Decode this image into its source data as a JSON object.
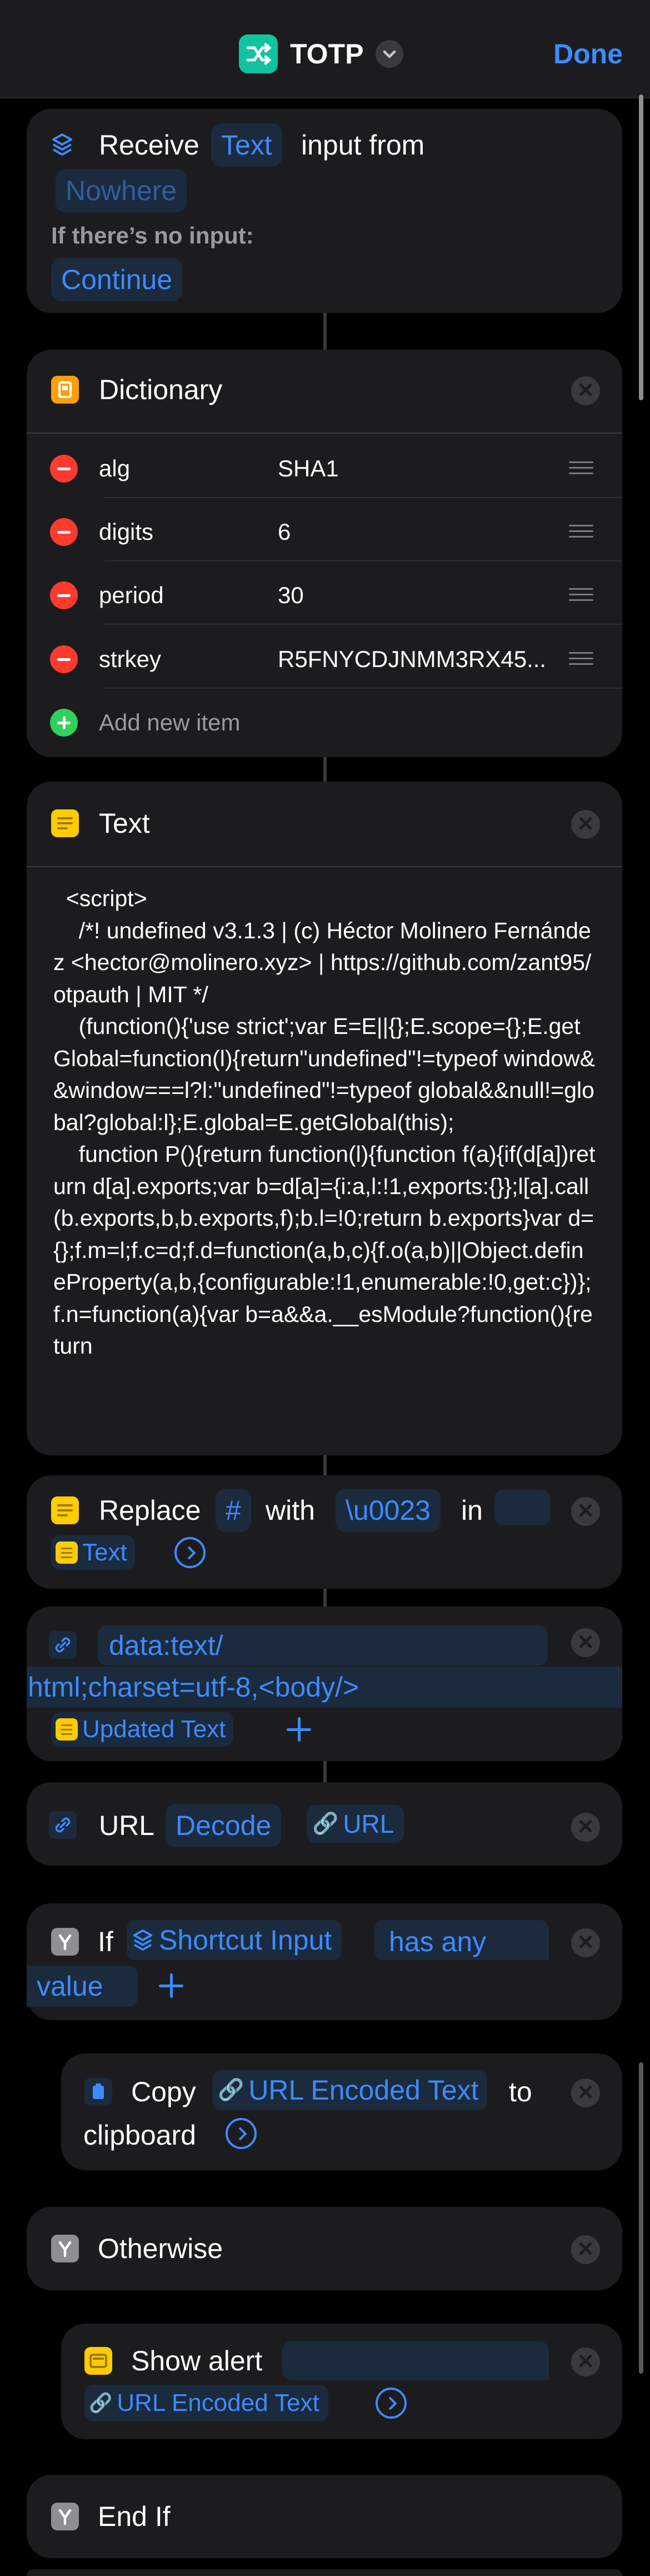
{
  "nav": {
    "title": "TOTP",
    "done": "Done",
    "app_icon": "shuffle-icon",
    "chevron_icon": "chevron-down-icon"
  },
  "receive": {
    "label_receive": "Receive",
    "input_type": "Text",
    "label_input_from": "input from",
    "source": "Nowhere",
    "no_input_label": "If there’s no input:",
    "no_input_action": "Continue"
  },
  "dictionary": {
    "title": "Dictionary",
    "items": [
      {
        "key": "alg",
        "value": "SHA1"
      },
      {
        "key": "digits",
        "value": "6"
      },
      {
        "key": "period",
        "value": "30"
      },
      {
        "key": "strkey",
        "value": "R5FNYCDJNMM3RX45..."
      }
    ],
    "add_label": "Add new item"
  },
  "text_action": {
    "title": "Text",
    "content": "  <script>\n    /*! undefined v3.1.3 | (c) Héctor Molinero Fernández <hector@molinero.xyz> | https://github.com/zant95/otpauth | MIT */\n    (function(){'use strict';var E=E||{};E.scope={};E.getGlobal=function(l){return\"undefined\"!=typeof window&&window===l?l:\"undefined\"!=typeof global&&null!=global?global:l};E.global=E.getGlobal(this);\n    function P(){return function(l){function f(a){if(d[a])return d[a].exports;var b=d[a]={i:a,l:!1,exports:{}};l[a].call(b.exports,b,b.exports,f);b.l=!0;return b.exports}var d={};f.m=l;f.c=d;f.d=function(a,b,c){f.o(a,b)||Object.defineProperty(a,b,{configurable:!1,enumerable:!0,get:c})};f.n=function(a){var b=a&&a.__esModule?function(){return"
  },
  "replace": {
    "label_replace": "Replace",
    "find": "#",
    "label_with": "with",
    "replacement": "\\u0023",
    "label_in": "in",
    "target": "Text"
  },
  "url_text": {
    "line1": "data:text/",
    "line2": "html;charset=utf-8,<body/>",
    "variable": "Updated Text"
  },
  "url_decode": {
    "label_url": "URL",
    "mode": "Decode",
    "variable": "URL"
  },
  "if_block": {
    "label_if": "If",
    "variable": "Shortcut Input",
    "condition_part1": "has any",
    "condition_part2": "value"
  },
  "copy": {
    "label_copy": "Copy",
    "variable": "URL Encoded Text",
    "label_to": "to",
    "label_clipboard": "clipboard"
  },
  "otherwise": {
    "label": "Otherwise"
  },
  "alert": {
    "label": "Show alert",
    "variable": "URL Encoded Text"
  },
  "endif": {
    "label": "End If"
  },
  "colors": {
    "background": "#000000",
    "card": "#1c1c1e",
    "accent": "#3d8bff",
    "danger": "#ff3b30",
    "success": "#30d158",
    "dictionary_icon": "#ff9f0a",
    "text_icon": "#ffcc00"
  }
}
